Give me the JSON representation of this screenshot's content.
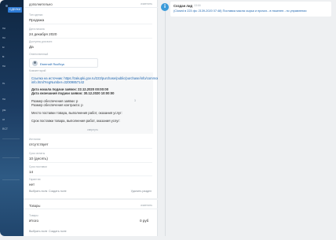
{
  "sidebar": {
    "badge": "СДЕЛКИ",
    "items": [
      "ты",
      "гы",
      "ы",
      "м",
      "ты",
      "ть",
      "ты",
      "ры",
      "ог",
      "RCT"
    ]
  },
  "card": {
    "section_title": "дополнительно",
    "section_action": "изменить",
    "fields": [
      {
        "label": "Тип сделки",
        "value": "Продажа"
      },
      {
        "label": "Дата начала",
        "value": "24 декабря 2020"
      },
      {
        "label": "Доступна для всех",
        "value": "Да"
      }
    ],
    "responsible": {
      "label": "Ответственный",
      "name": "Евгений Якобчук"
    },
    "comment": {
      "label": "Комментарий",
      "lines": [
        "Ссылка на источник: https://zakupki.gov.ru/223/purchase/public/purchase/info/common-",
        "info.html?regNumber=32009857142",
        "Дата начала подачи заявок: 22.12.2020 00:00:00",
        "Дата окончания подачи заявок: 30.12.2020 10:00:00",
        "Размер обеспечения заявки: р",
        "Размер обеспечения контракта: р",
        "Место поставки товара, выполнения работ, оказания услуг:",
        "Срок поставки товара, выполнения работ, оказания услуг:"
      ],
      "collapse": "свернуть",
      "num": "3"
    },
    "more_fields": [
      {
        "label": "Источник",
        "value": "отсутствует"
      },
      {
        "label": "Срок оплаты",
        "value": "10 (десять)"
      },
      {
        "label": "Срок поставки",
        "value": "14"
      },
      {
        "label": "Гарантия",
        "value": "нет"
      }
    ],
    "footer": {
      "choose": "Выбрать поля",
      "create": "Создать поле",
      "delete": "Удалить раздел"
    },
    "goods": {
      "title": "Товары",
      "action": "изменить",
      "label": "Товары",
      "total_label": "Итого",
      "total_value": "0 руб",
      "footer_choose": "Выбрать поле",
      "footer_create": "Создать поле"
    }
  },
  "timeline": {
    "icon": "i",
    "event_title": "Создан лид",
    "event_time": "13:16",
    "event_text": "(Closed в 223 фз: 2139-2020 07:48) Поставка масла сырья и прочих...в тяжелее...но управлении"
  }
}
